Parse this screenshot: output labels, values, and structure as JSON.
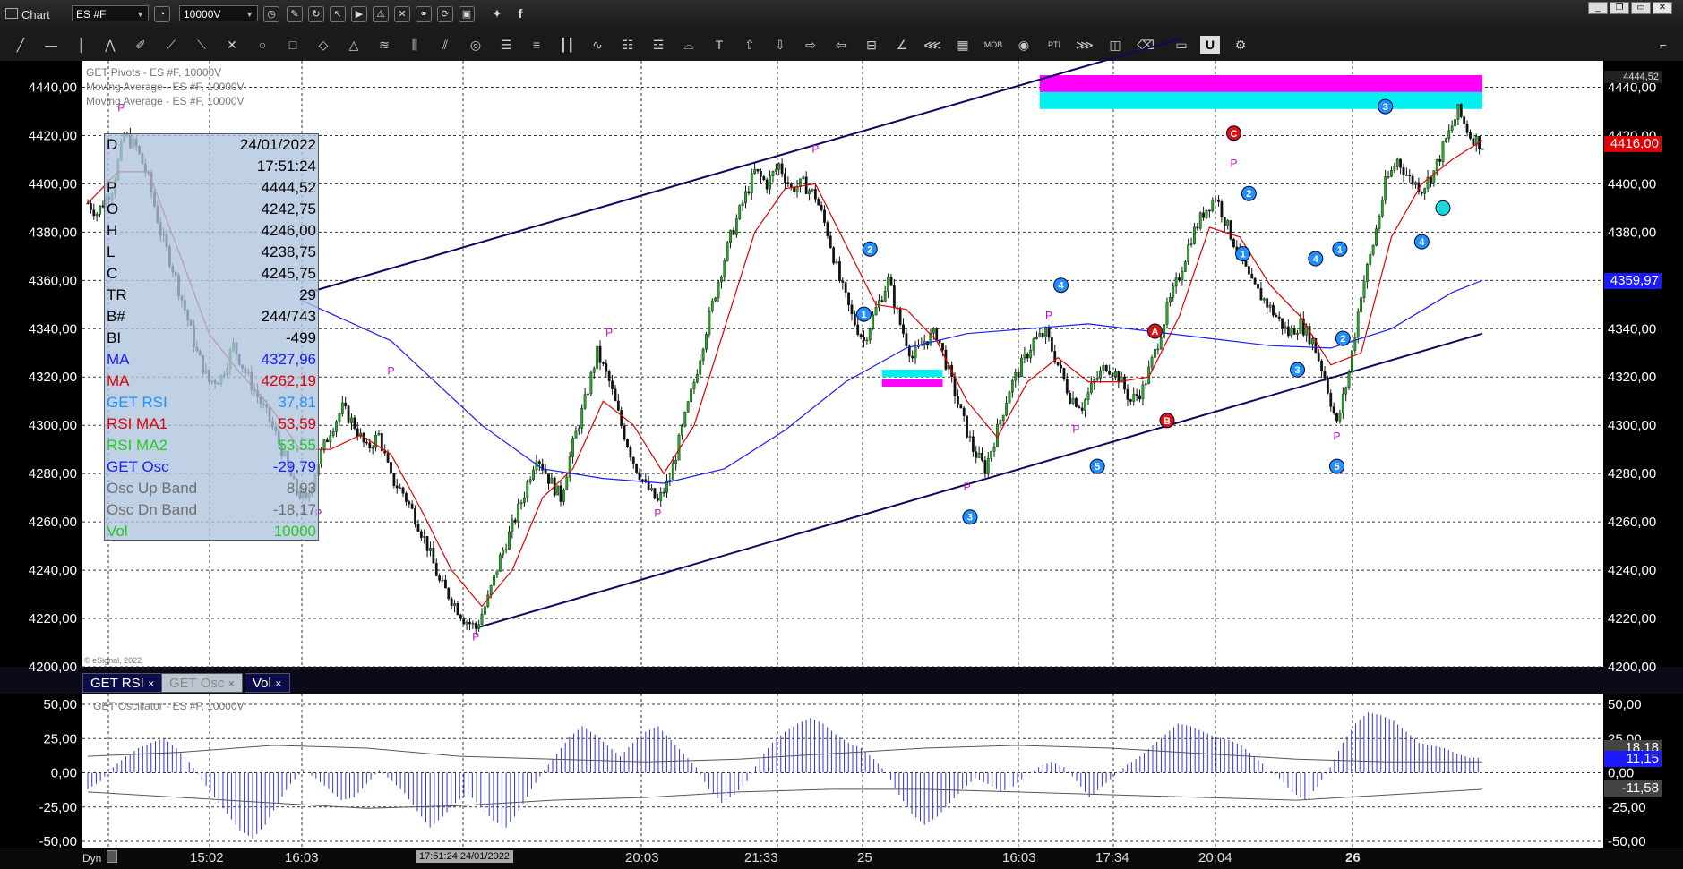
{
  "window": {
    "title": "Chart",
    "symbol": "ES #F",
    "interval": "10000V",
    "controls": [
      "minimize",
      "restore",
      "close"
    ]
  },
  "legend": {
    "lines": [
      "GET Pivots - ES #F, 10000V",
      "Moving Average - ES #F, 10000V",
      "Moving Average - ES #F, 10000V"
    ],
    "copyright": "© eSignal, 2022"
  },
  "info_panel": [
    {
      "key": "D",
      "value": "24/01/2022",
      "color": "#000000",
      "value_color": "#000000"
    },
    {
      "key": "",
      "value": "17:51:24",
      "color": "#000000",
      "value_color": "#000000"
    },
    {
      "key": "P",
      "value": "4444,52",
      "color": "#000000",
      "value_color": "#000000"
    },
    {
      "key": "O",
      "value": "4242,75",
      "color": "#000000",
      "value_color": "#000000"
    },
    {
      "key": "H",
      "value": "4246,00",
      "color": "#000000",
      "value_color": "#000000"
    },
    {
      "key": "L",
      "value": "4238,75",
      "color": "#000000",
      "value_color": "#000000"
    },
    {
      "key": "C",
      "value": "4245,75",
      "color": "#000000",
      "value_color": "#000000"
    },
    {
      "key": "TR",
      "value": "29",
      "color": "#000000",
      "value_color": "#000000"
    },
    {
      "key": "B#",
      "value": "244/743",
      "color": "#000000",
      "value_color": "#000000"
    },
    {
      "key": "BI",
      "value": "-499",
      "color": "#000000",
      "value_color": "#000000"
    },
    {
      "key": "MA",
      "value": "4327,96",
      "color": "#1a1aff",
      "value_color": "#1a1aff"
    },
    {
      "key": "MA",
      "value": "4262,19",
      "color": "#e00000",
      "value_color": "#e00000"
    },
    {
      "key": "GET RSI",
      "value": "37,81",
      "color": "#1e90ff",
      "value_color": "#1e90ff"
    },
    {
      "key": "RSI MA1",
      "value": "53,59",
      "color": "#e00000",
      "value_color": "#e00000"
    },
    {
      "key": "RSI MA2",
      "value": "53,55",
      "color": "#22cc22",
      "value_color": "#22cc22"
    },
    {
      "key": "GET Osc",
      "value": "-29,79",
      "color": "#1a1aff",
      "value_color": "#1a1aff"
    },
    {
      "key": "Osc Up Band",
      "value": "8,93",
      "color": "#6e6e6e",
      "value_color": "#6e6e6e"
    },
    {
      "key": "Osc Dn Band",
      "value": "-18,17",
      "color": "#6e6e6e",
      "value_color": "#6e6e6e"
    },
    {
      "key": "Vol",
      "value": "10000",
      "color": "#22cc22",
      "value_color": "#22cc22"
    }
  ],
  "price_axis": {
    "ticks": [
      "4440,00",
      "4420,00",
      "4400,00",
      "4380,00",
      "4360,00",
      "4340,00",
      "4320,00",
      "4300,00",
      "4280,00",
      "4260,00",
      "4240,00",
      "4220,00",
      "4200,00"
    ],
    "top_marker": "4444,52",
    "current_price": "4416,00",
    "ma_price": "4359,97"
  },
  "time_axis": {
    "labels": [
      "15:02",
      "16:03",
      "20:03",
      "21:33",
      "25",
      "16:03",
      "17:34",
      "20:04",
      "26"
    ],
    "cursor_label": "17:51:24 24/01/2022",
    "left_label": "Dyn"
  },
  "sub_tabs": [
    "GET RSI",
    "GET Osc",
    "Vol"
  ],
  "oscillator": {
    "legend": "GET Oscillator - ES #F, 10000V",
    "ticks": [
      "50,00",
      "25,00",
      "0,00",
      "-25,00",
      "-50,00"
    ],
    "markers": [
      "18,18",
      "11,15",
      "0,00",
      "-11,58"
    ]
  },
  "chart_data": {
    "type": "candlestick",
    "symbol": "ES #F",
    "ylim": [
      4200,
      4445
    ],
    "close_path": [
      [
        0,
        4392
      ],
      [
        3,
        4388
      ],
      [
        8,
        4398
      ],
      [
        12,
        4420
      ],
      [
        16,
        4415
      ],
      [
        20,
        4402
      ],
      [
        24,
        4380
      ],
      [
        28,
        4365
      ],
      [
        32,
        4348
      ],
      [
        36,
        4330
      ],
      [
        40,
        4318
      ],
      [
        44,
        4320
      ],
      [
        48,
        4333
      ],
      [
        52,
        4322
      ],
      [
        56,
        4312
      ],
      [
        60,
        4302
      ],
      [
        64,
        4290
      ],
      [
        68,
        4275
      ],
      [
        72,
        4268
      ],
      [
        76,
        4285
      ],
      [
        80,
        4298
      ],
      [
        84,
        4307
      ],
      [
        88,
        4300
      ],
      [
        92,
        4290
      ],
      [
        96,
        4296
      ],
      [
        100,
        4278
      ],
      [
        104,
        4272
      ],
      [
        108,
        4262
      ],
      [
        112,
        4250
      ],
      [
        116,
        4235
      ],
      [
        120,
        4228
      ],
      [
        124,
        4220
      ],
      [
        128,
        4216
      ],
      [
        132,
        4228
      ],
      [
        136,
        4245
      ],
      [
        140,
        4258
      ],
      [
        144,
        4272
      ],
      [
        148,
        4288
      ],
      [
        152,
        4278
      ],
      [
        156,
        4270
      ],
      [
        160,
        4292
      ],
      [
        164,
        4310
      ],
      [
        168,
        4330
      ],
      [
        172,
        4318
      ],
      [
        176,
        4300
      ],
      [
        180,
        4285
      ],
      [
        184,
        4275
      ],
      [
        188,
        4268
      ],
      [
        192,
        4278
      ],
      [
        196,
        4298
      ],
      [
        200,
        4318
      ],
      [
        204,
        4340
      ],
      [
        208,
        4360
      ],
      [
        212,
        4378
      ],
      [
        216,
        4392
      ],
      [
        220,
        4405
      ],
      [
        224,
        4400
      ],
      [
        228,
        4408
      ],
      [
        232,
        4398
      ],
      [
        236,
        4400
      ],
      [
        240,
        4395
      ],
      [
        244,
        4380
      ],
      [
        248,
        4360
      ],
      [
        252,
        4345
      ],
      [
        256,
        4335
      ],
      [
        260,
        4348
      ],
      [
        264,
        4360
      ],
      [
        268,
        4342
      ],
      [
        272,
        4328
      ],
      [
        276,
        4335
      ],
      [
        280,
        4338
      ],
      [
        284,
        4322
      ],
      [
        288,
        4305
      ],
      [
        292,
        4290
      ],
      [
        296,
        4282
      ],
      [
        300,
        4298
      ],
      [
        304,
        4315
      ],
      [
        308,
        4325
      ],
      [
        312,
        4335
      ],
      [
        316,
        4338
      ],
      [
        320,
        4325
      ],
      [
        324,
        4312
      ],
      [
        328,
        4308
      ],
      [
        332,
        4318
      ],
      [
        336,
        4325
      ],
      [
        340,
        4320
      ],
      [
        344,
        4310
      ],
      [
        348,
        4315
      ],
      [
        352,
        4330
      ],
      [
        356,
        4348
      ],
      [
        360,
        4362
      ],
      [
        364,
        4378
      ],
      [
        368,
        4388
      ],
      [
        372,
        4395
      ],
      [
        376,
        4382
      ],
      [
        380,
        4370
      ],
      [
        384,
        4358
      ],
      [
        388,
        4352
      ],
      [
        392,
        4345
      ],
      [
        396,
        4338
      ],
      [
        400,
        4342
      ],
      [
        404,
        4335
      ],
      [
        408,
        4320
      ],
      [
        412,
        4300
      ],
      [
        416,
        4322
      ],
      [
        420,
        4355
      ],
      [
        424,
        4375
      ],
      [
        428,
        4400
      ],
      [
        432,
        4410
      ],
      [
        436,
        4402
      ],
      [
        440,
        4398
      ],
      [
        444,
        4405
      ],
      [
        448,
        4418
      ],
      [
        452,
        4430
      ],
      [
        456,
        4420
      ],
      [
        460,
        4416
      ]
    ],
    "ma_fast_path": [
      [
        0,
        4392
      ],
      [
        10,
        4405
      ],
      [
        20,
        4405
      ],
      [
        30,
        4372
      ],
      [
        40,
        4338
      ],
      [
        50,
        4322
      ],
      [
        60,
        4308
      ],
      [
        70,
        4290
      ],
      [
        80,
        4290
      ],
      [
        90,
        4296
      ],
      [
        100,
        4288
      ],
      [
        110,
        4265
      ],
      [
        120,
        4240
      ],
      [
        130,
        4225
      ],
      [
        140,
        4240
      ],
      [
        150,
        4270
      ],
      [
        160,
        4282
      ],
      [
        170,
        4310
      ],
      [
        180,
        4300
      ],
      [
        190,
        4280
      ],
      [
        200,
        4300
      ],
      [
        210,
        4340
      ],
      [
        220,
        4380
      ],
      [
        230,
        4398
      ],
      [
        240,
        4400
      ],
      [
        250,
        4375
      ],
      [
        260,
        4350
      ],
      [
        270,
        4348
      ],
      [
        280,
        4335
      ],
      [
        290,
        4310
      ],
      [
        300,
        4295
      ],
      [
        310,
        4318
      ],
      [
        320,
        4328
      ],
      [
        330,
        4318
      ],
      [
        340,
        4318
      ],
      [
        350,
        4320
      ],
      [
        360,
        4345
      ],
      [
        370,
        4382
      ],
      [
        380,
        4378
      ],
      [
        390,
        4358
      ],
      [
        400,
        4345
      ],
      [
        410,
        4325
      ],
      [
        420,
        4330
      ],
      [
        430,
        4378
      ],
      [
        440,
        4400
      ],
      [
        450,
        4410
      ],
      [
        460,
        4418
      ]
    ],
    "ma_slow_path": [
      [
        70,
        4352
      ],
      [
        100,
        4335
      ],
      [
        130,
        4300
      ],
      [
        150,
        4282
      ],
      [
        170,
        4278
      ],
      [
        190,
        4276
      ],
      [
        210,
        4282
      ],
      [
        230,
        4298
      ],
      [
        250,
        4318
      ],
      [
        270,
        4332
      ],
      [
        290,
        4338
      ],
      [
        310,
        4340
      ],
      [
        330,
        4342
      ],
      [
        350,
        4339
      ],
      [
        370,
        4336
      ],
      [
        390,
        4333
      ],
      [
        410,
        4332
      ],
      [
        430,
        4340
      ],
      [
        450,
        4355
      ],
      [
        460,
        4360
      ]
    ],
    "channel_upper": [
      [
        70,
        4354
      ],
      [
        360,
        4460
      ]
    ],
    "channel_lower": [
      [
        128,
        4216
      ],
      [
        460,
        4338
      ]
    ],
    "pivot_labels": [
      {
        "x": 11,
        "y": 4430,
        "text": "P"
      },
      {
        "x": 66,
        "y": 4315,
        "text": "P"
      },
      {
        "x": 76,
        "y": 4262,
        "text": "P"
      },
      {
        "x": 100,
        "y": 4321,
        "text": "P"
      },
      {
        "x": 128,
        "y": 4211,
        "text": "P"
      },
      {
        "x": 172,
        "y": 4337,
        "text": "P"
      },
      {
        "x": 188,
        "y": 4262,
        "text": "P"
      },
      {
        "x": 240,
        "y": 4413,
        "text": "P"
      },
      {
        "x": 290,
        "y": 4273,
        "text": "P"
      },
      {
        "x": 317,
        "y": 4344,
        "text": "P"
      },
      {
        "x": 326,
        "y": 4297,
        "text": "P"
      },
      {
        "x": 378,
        "y": 4407,
        "text": "P"
      },
      {
        "x": 412,
        "y": 4294,
        "text": "P"
      }
    ],
    "wave_labels": [
      {
        "x": 258,
        "y": 4373,
        "text": "2",
        "style": "circle",
        "color": "#1e90ff"
      },
      {
        "x": 256,
        "y": 4346,
        "text": "1",
        "style": "circle",
        "color": "#1e90ff"
      },
      {
        "x": 321,
        "y": 4358,
        "text": "4",
        "style": "circle",
        "color": "#1e90ff"
      },
      {
        "x": 333,
        "y": 4283,
        "text": "5",
        "style": "circle",
        "color": "#1e90ff"
      },
      {
        "x": 291,
        "y": 4262,
        "text": "3",
        "style": "circle",
        "color": "#1e90ff"
      },
      {
        "x": 352,
        "y": 4339,
        "text": "A",
        "style": "circle",
        "color": "#e01010"
      },
      {
        "x": 356,
        "y": 4302,
        "text": "B",
        "style": "circle",
        "color": "#e01010"
      },
      {
        "x": 378,
        "y": 4421,
        "text": "C",
        "style": "circle",
        "color": "#e01010"
      },
      {
        "x": 383,
        "y": 4396,
        "text": "2",
        "style": "circle",
        "color": "#1e90ff"
      },
      {
        "x": 381,
        "y": 4371,
        "text": "1",
        "style": "circle",
        "color": "#1e90ff"
      },
      {
        "x": 405,
        "y": 4369,
        "text": "4",
        "style": "circle",
        "color": "#1e90ff"
      },
      {
        "x": 399,
        "y": 4323,
        "text": "3",
        "style": "circle",
        "color": "#1e90ff"
      },
      {
        "x": 412,
        "y": 4283,
        "text": "5",
        "style": "circle",
        "color": "#1e90ff"
      },
      {
        "x": 414,
        "y": 4336,
        "text": "2",
        "style": "circle",
        "color": "#1e90ff"
      },
      {
        "x": 413,
        "y": 4373,
        "text": "1",
        "style": "circle",
        "color": "#1e90ff"
      },
      {
        "x": 428,
        "y": 4432,
        "text": "3",
        "style": "circle",
        "color": "#1e90ff"
      },
      {
        "x": 440,
        "y": 4376,
        "text": "4",
        "style": "circle",
        "color": "#1e90ff"
      },
      {
        "x": 447,
        "y": 4390,
        "text": "",
        "style": "circle",
        "color": "#1fd6d6"
      }
    ],
    "zones": [
      {
        "x0": 314,
        "x1": 460,
        "y0": 4438,
        "y1": 4445,
        "color": "#ff00ff"
      },
      {
        "x0": 314,
        "x1": 460,
        "y0": 4431,
        "y1": 4438,
        "color": "#00f0f0"
      },
      {
        "x0": 262,
        "x1": 282,
        "y0": 4320,
        "y1": 4323,
        "color": "#00f0f0"
      },
      {
        "x0": 262,
        "x1": 282,
        "y0": 4316,
        "y1": 4319,
        "color": "#ff00ff"
      }
    ],
    "oscillator_values": [
      -12,
      -6,
      4,
      12,
      18,
      22,
      25,
      18,
      8,
      -5,
      -18,
      -30,
      -42,
      -48,
      -38,
      -22,
      -8,
      2,
      -4,
      -12,
      -20,
      -18,
      -8,
      2,
      -6,
      -15,
      -28,
      -40,
      -32,
      -22,
      -15,
      -25,
      -35,
      -40,
      -28,
      -12,
      2,
      14,
      26,
      34,
      28,
      20,
      12,
      22,
      30,
      34,
      24,
      14,
      4,
      -12,
      -22,
      -16,
      -6,
      10,
      22,
      30,
      36,
      40,
      36,
      28,
      22,
      18,
      10,
      0,
      -16,
      -30,
      -38,
      -32,
      -22,
      -12,
      -4,
      -8,
      -14,
      -10,
      -2,
      4,
      8,
      4,
      -6,
      -18,
      -10,
      -2,
      6,
      12,
      20,
      28,
      36,
      34,
      30,
      26,
      24,
      20,
      12,
      4,
      -4,
      -14,
      -20,
      -10,
      4,
      22,
      36,
      44,
      42,
      38,
      30,
      22,
      20,
      18,
      14,
      11
    ],
    "osc_band_up": [
      12,
      15,
      20,
      18,
      12,
      10,
      8,
      10,
      14,
      18,
      20,
      18,
      14,
      10,
      8,
      8
    ],
    "osc_band_dn": [
      -14,
      -18,
      -22,
      -26,
      -24,
      -20,
      -18,
      -14,
      -12,
      -12,
      -14,
      -16,
      -18,
      -20,
      -16,
      -12
    ]
  }
}
